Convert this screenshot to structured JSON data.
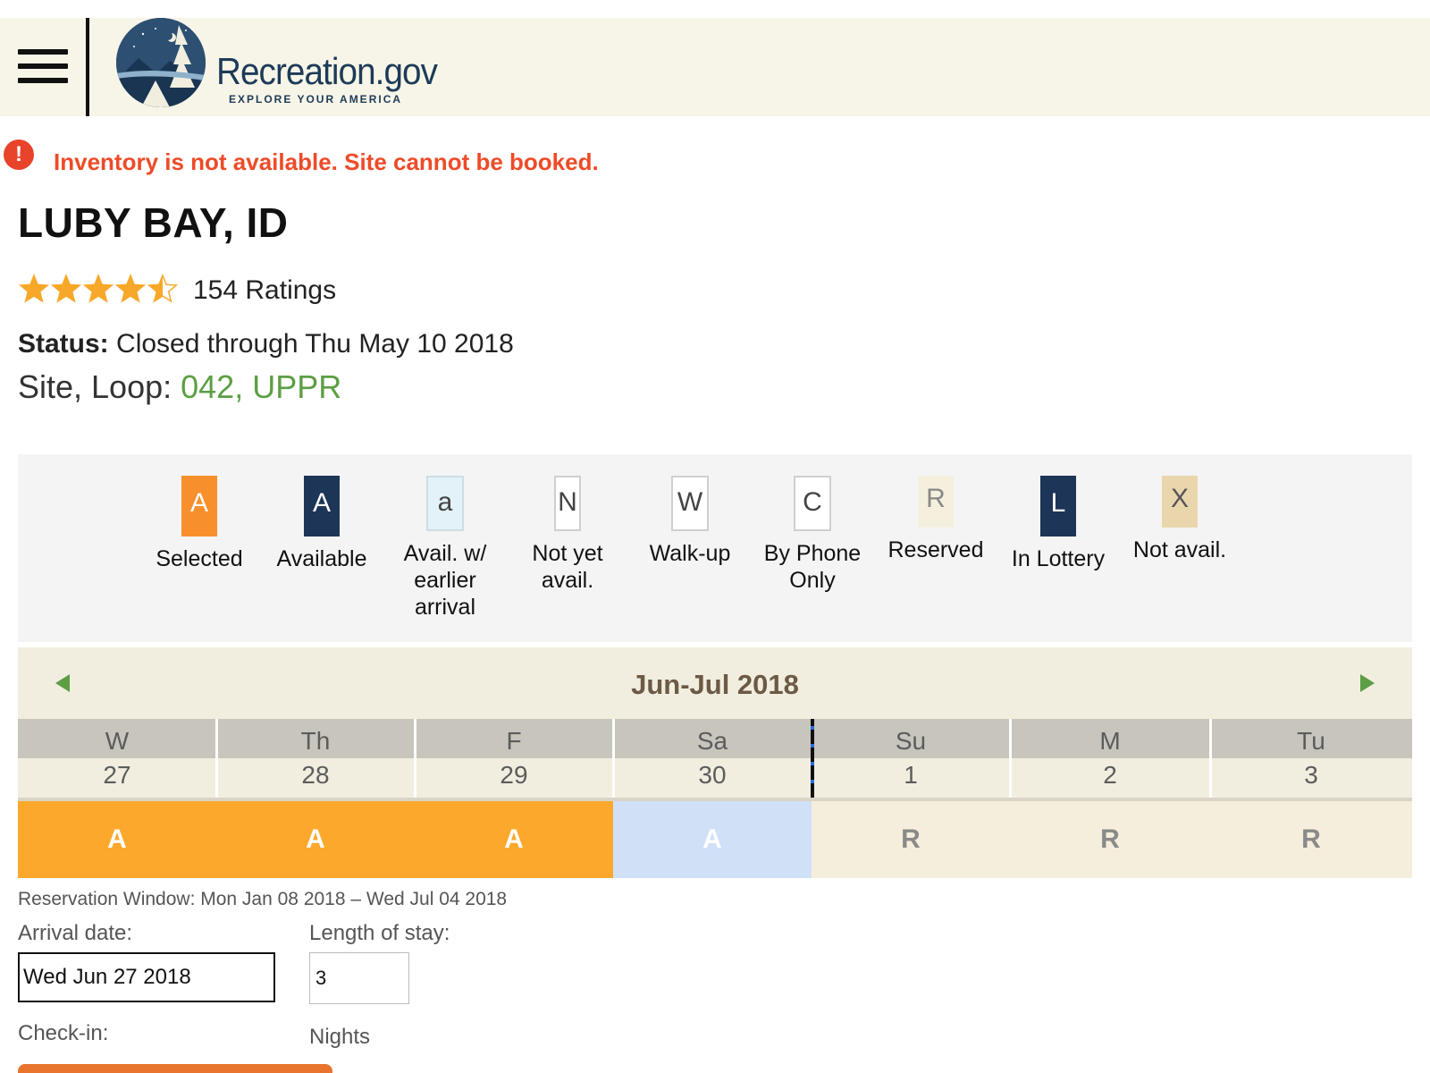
{
  "header": {
    "logo_name": "Recreation.gov",
    "logo_tagline": "EXPLORE YOUR AMERICA"
  },
  "alert": {
    "icon": "!",
    "message": "Inventory is not available. Site cannot be booked."
  },
  "facility": {
    "title": "LUBY BAY, ID",
    "rating_value": 4.5,
    "rating_max": 5,
    "rating_count_text": "154 Ratings",
    "status_label": "Status:",
    "status_value": "Closed through Thu May 10 2018",
    "site_loop_label": "Site, Loop:",
    "site_loop_value": "042, UPPR"
  },
  "legend": [
    {
      "code": "A",
      "label": "Selected",
      "style": "selected"
    },
    {
      "code": "A",
      "label": "Available",
      "style": "available"
    },
    {
      "code": "a",
      "label": "Avail. w/ earlier arrival",
      "style": "early"
    },
    {
      "code": "N",
      "label": "Not yet avail.",
      "style": "notyet"
    },
    {
      "code": "W",
      "label": "Walk-up",
      "style": "walkup"
    },
    {
      "code": "C",
      "label": "By Phone Only",
      "style": "phone"
    },
    {
      "code": "R",
      "label": "Reserved",
      "style": "reserved"
    },
    {
      "code": "L",
      "label": "In Lottery",
      "style": "lottery"
    },
    {
      "code": "X",
      "label": "Not avail.",
      "style": "notavail"
    }
  ],
  "calendar": {
    "title": "Jun-Jul 2018",
    "days": [
      {
        "dow": "W",
        "day": "27",
        "code": "A",
        "state": "selected"
      },
      {
        "dow": "Th",
        "day": "28",
        "code": "A",
        "state": "selected"
      },
      {
        "dow": "F",
        "day": "29",
        "code": "A",
        "state": "selected"
      },
      {
        "dow": "Sa",
        "day": "30",
        "code": "A",
        "state": "preview"
      },
      {
        "dow": "Su",
        "day": "1",
        "code": "R",
        "state": "reserved"
      },
      {
        "dow": "M",
        "day": "2",
        "code": "R",
        "state": "reserved"
      },
      {
        "dow": "Tu",
        "day": "3",
        "code": "R",
        "state": "reserved"
      }
    ]
  },
  "booking": {
    "reservation_window": "Reservation Window: Mon Jan 08 2018 – Wed Jul 04 2018",
    "arrival_label": "Arrival date:",
    "arrival_value": "Wed Jun 27 2018",
    "stay_label": "Length of stay:",
    "stay_value": "3",
    "checkin_label": "Check-in:",
    "nights_label": "Nights"
  },
  "colors": {
    "alert_red": "#ee4b28",
    "site_green": "#5c9e44",
    "selected_orange": "#fca82c",
    "available_navy": "#1d3557",
    "nav_arrow_green": "#5c9e44"
  }
}
